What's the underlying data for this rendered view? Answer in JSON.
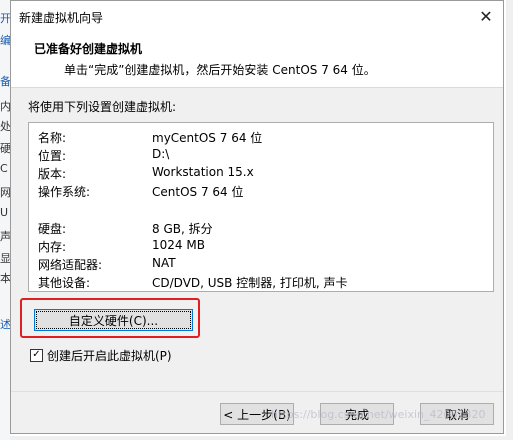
{
  "background": {
    "left_glyphs": [
      "开",
      "编",
      "备",
      "内",
      "处",
      "硬",
      "C",
      "网",
      "U",
      "声",
      "显",
      "本",
      "述"
    ]
  },
  "dialog": {
    "title": "新建虚拟机向导",
    "close_glyph": "✕",
    "header": {
      "title": "已准备好创建虚拟机",
      "subtitle": "单击“完成”创建虚拟机，然后开始安装 CentOS 7 64 位。"
    },
    "intro": "将使用下列设置创建虚拟机:",
    "summary": [
      {
        "key": "名称:",
        "value": "myCentOS 7 64 位"
      },
      {
        "key": "位置:",
        "value": "D:\\"
      },
      {
        "key": "版本:",
        "value": "Workstation 15.x"
      },
      {
        "key": "操作系统:",
        "value": "CentOS 7 64 位"
      },
      {
        "key": "硬盘:",
        "value": "8 GB, 拆分"
      },
      {
        "key": "内存:",
        "value": "1024 MB"
      },
      {
        "key": "网络适配器:",
        "value": "NAT"
      },
      {
        "key": "其他设备:",
        "value": "CD/DVD, USB 控制器, 打印机, 声卡"
      }
    ],
    "customize_button": "自定义硬件(C)...",
    "power_on_checkbox": {
      "label": "创建后开启此虚拟机(P)",
      "checked": true,
      "mark": "✓"
    },
    "buttons": {
      "back": "< 上一步(B)",
      "finish": "完成",
      "cancel": "取消"
    }
  },
  "watermark": "https://blog.csdn.net/weixin_42081320",
  "colors": {
    "highlight_border": "#e02020",
    "focus_border": "#0078d7",
    "dialog_bg": "#f0f0f0"
  }
}
